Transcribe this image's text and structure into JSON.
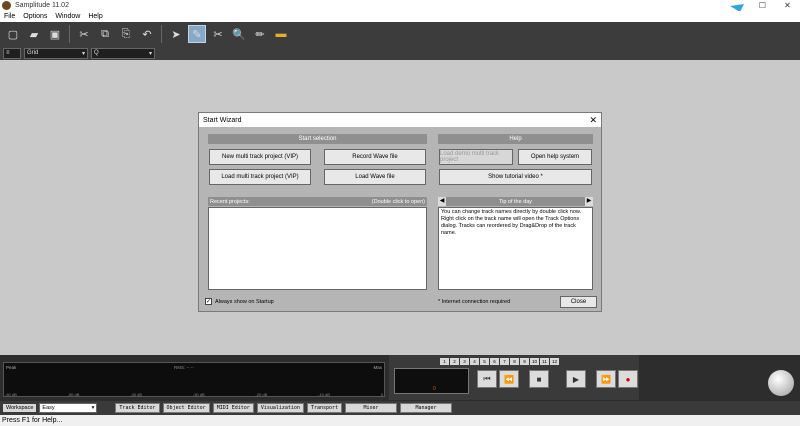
{
  "window": {
    "title": "Samplitude 11.02",
    "min": "—",
    "max": "☐",
    "close": "✕"
  },
  "menu": [
    "File",
    "Options",
    "Window",
    "Help"
  ],
  "toolbar": {
    "icons": [
      "new-file-icon",
      "open-folder-icon",
      "save-icon",
      "save-all-icon",
      "cut-icon",
      "copy-icon",
      "paste-icon",
      "pointer-icon",
      "draw-icon",
      "scissors-icon",
      "zoom-icon",
      "pencil-icon",
      "ruler-icon"
    ],
    "grid_label": "Grid",
    "q_label": "Q",
    "q_value": "Q"
  },
  "dialog": {
    "title": "Start Wizard",
    "start_selection": "Start selection",
    "help": "Help",
    "buttons": {
      "new_multi": "New multi track project (VIP)",
      "record_wave": "Record Wave file",
      "load_multi": "Load multi track project (VIP)",
      "load_wave": "Load Wave file",
      "load_demo": "Load demo multi track project",
      "open_help": "Open help system",
      "tutorial": "Show tutorial video *",
      "close": "Close"
    },
    "recent_projects": "Recent projects:",
    "double_click": "(Double click to open)",
    "tip_title": "Tip of the day",
    "tip_text": "You can change track names directly by double click now. Right click on the track name will open the Track Options dialog. Tracks can reordered by Drag&Drop of the track name.",
    "always_show": "Always show on Startup",
    "internet": "* Internet connection required"
  },
  "meter": {
    "peak_label": "Peak",
    "max_label": "Max",
    "rms_label": "RMS: -- --",
    "scale": [
      "-60 dB",
      "-50 dB",
      "-40 dB",
      "-30 dB",
      "-20 dB",
      "-10 dB",
      "0"
    ]
  },
  "transport": {
    "markers": [
      "1",
      "2",
      "3",
      "4",
      "5",
      "6",
      "7",
      "8",
      "9",
      "10",
      "11",
      "12"
    ],
    "display_marker": "0"
  },
  "workspace": {
    "label": "Workspace",
    "value": "Easy",
    "buttons": [
      "Track Editor",
      "Object Editor",
      "MIDI Editor",
      "Visualization",
      "Transport",
      "Mixer",
      "Manager"
    ]
  },
  "status": {
    "text": "Press F1 for Help..."
  }
}
